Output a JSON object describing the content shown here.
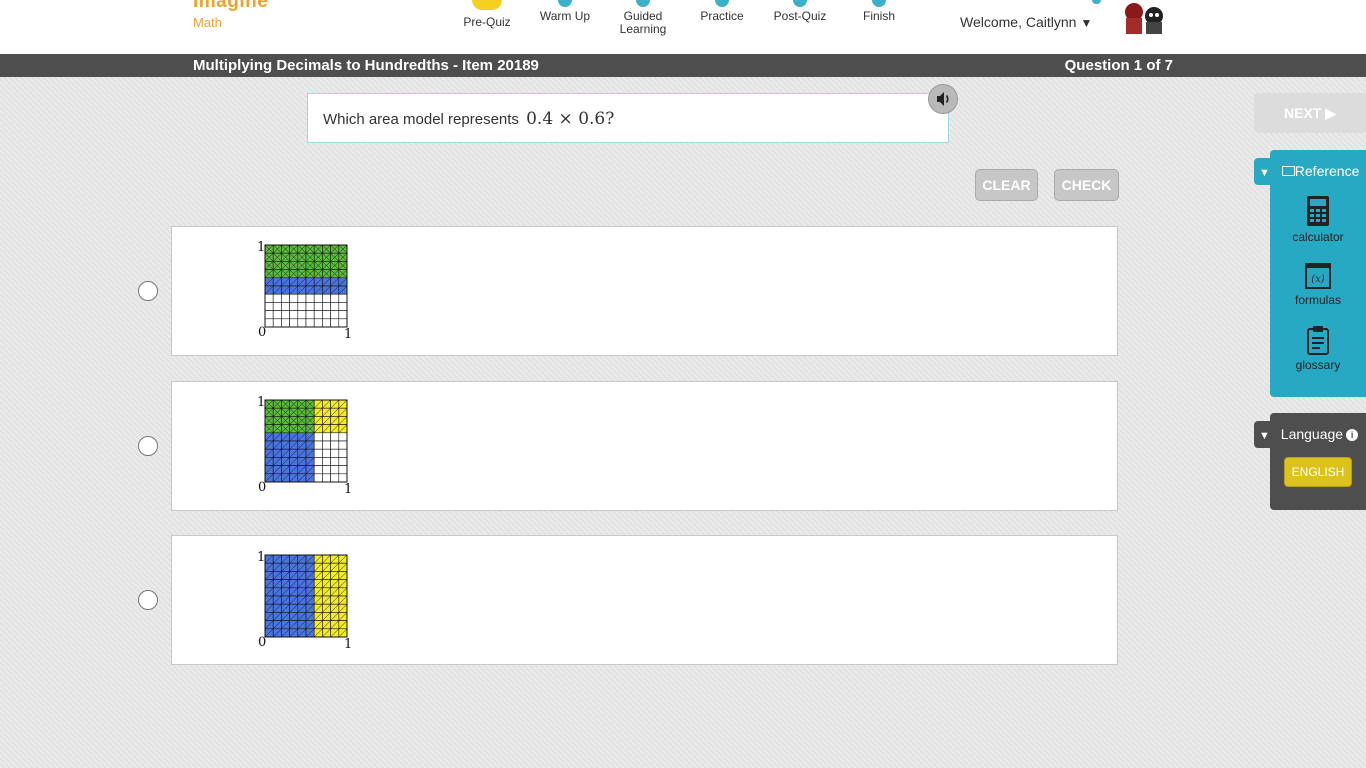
{
  "header": {
    "logo_main": "Imagine",
    "logo_sub": "Math",
    "steps": [
      {
        "label": "Pre-Quiz"
      },
      {
        "label": "Warm Up"
      },
      {
        "label": "Guided Learning"
      },
      {
        "label": "Practice"
      },
      {
        "label": "Post-Quiz"
      },
      {
        "label": "Finish"
      }
    ],
    "welcome": "Welcome, Caitlynn"
  },
  "titlebar": {
    "title": "Multiplying Decimals to Hundredths - Item 20189",
    "progress": "Question 1 of 7"
  },
  "question": {
    "text": "Which area model represents",
    "math": "0.4 × 0.6?"
  },
  "actions": {
    "clear": "CLEAR",
    "check": "CHECK",
    "next": "NEXT ▶"
  },
  "answers": [
    {
      "shading": "green rows 0.4, blue rows 0.6 overlapping",
      "labels": {
        "zero": "0",
        "one_x": "1",
        "one_y": "1"
      }
    },
    {
      "shading": "green/yellow top 0.4, blue left 0.6",
      "labels": {
        "zero": "0",
        "one_x": "1",
        "one_y": "1"
      }
    },
    {
      "shading": "blue left 0.6, yellow right 0.4",
      "labels": {
        "zero": "0",
        "one_x": "1",
        "one_y": "1"
      }
    }
  ],
  "reference": {
    "title": "Reference",
    "tools": [
      {
        "label": "calculator",
        "icon": "calculator-icon"
      },
      {
        "label": "formulas",
        "icon": "formulas-icon"
      },
      {
        "label": "glossary",
        "icon": "glossary-icon"
      }
    ]
  },
  "language": {
    "title": "Language",
    "current": "ENGLISH"
  },
  "colors": {
    "accent": "#27a9c3",
    "logo": "#f0a030",
    "green": "#5bbd3b",
    "blue": "#4a74e0",
    "yellow": "#f3ec1e",
    "titlebar": "#4e4e4e"
  }
}
